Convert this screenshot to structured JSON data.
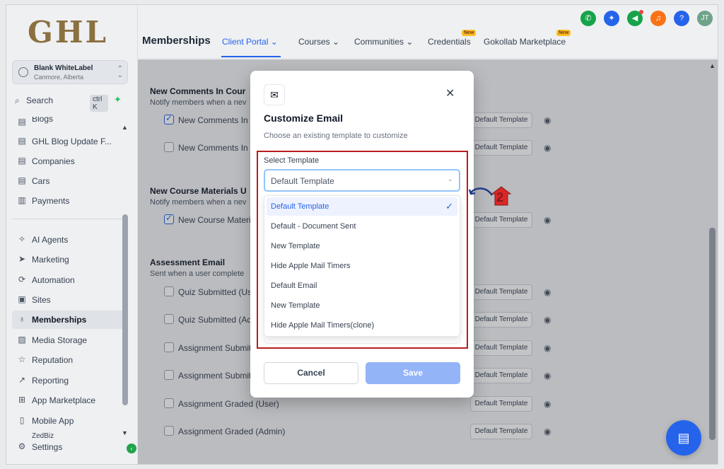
{
  "app": {
    "logo": "GHL"
  },
  "account": {
    "name": "Blank WhiteLabel",
    "location": "Canmore, Alberta"
  },
  "search": {
    "label": "Search",
    "shortcut": "ctrl K"
  },
  "sidebar": {
    "items": [
      {
        "label": "Blogs",
        "icon": "doc-icon"
      },
      {
        "label": "GHL Blog Update F...",
        "icon": "doc-icon"
      },
      {
        "label": "Companies",
        "icon": "doc-icon"
      },
      {
        "label": "Cars",
        "icon": "doc-icon"
      },
      {
        "label": "Payments",
        "icon": "receipt-icon"
      },
      {
        "label": "AI Agents",
        "icon": "sparkle-icon"
      },
      {
        "label": "Marketing",
        "icon": "send-icon"
      },
      {
        "label": "Automation",
        "icon": "automation-icon"
      },
      {
        "label": "Sites",
        "icon": "sites-icon"
      },
      {
        "label": "Memberships",
        "icon": "award-icon"
      },
      {
        "label": "Media Storage",
        "icon": "image-icon"
      },
      {
        "label": "Reputation",
        "icon": "star-icon"
      },
      {
        "label": "Reporting",
        "icon": "trend-icon"
      },
      {
        "label": "App Marketplace",
        "icon": "grid-icon"
      },
      {
        "label": "Mobile App",
        "icon": "phone-icon"
      },
      {
        "label": "ZedBiz",
        "icon": "doc-icon"
      },
      {
        "label": "Settings",
        "icon": "gear-icon"
      }
    ]
  },
  "header": {
    "title": "Memberships",
    "tabs": [
      {
        "label": "Client Portal",
        "active": true
      },
      {
        "label": "Courses"
      },
      {
        "label": "Communities"
      },
      {
        "label": "Credentials",
        "badge": "New"
      },
      {
        "label": "Gokollab Marketplace",
        "badge": "New"
      }
    ],
    "avatar_initials": "JT",
    "icon_colors": {
      "phone": "#16a34a",
      "magic": "#2563eb",
      "megaphone": "#16a34a",
      "bell": "#f97316",
      "help": "#2563eb",
      "avatar": "#6ea38a"
    }
  },
  "main": {
    "sections": [
      {
        "title": "New Comments In Cour",
        "subtitle": "Notify members when a nev",
        "rows": [
          {
            "label": "New Comments In C",
            "checked": true,
            "template": "Default Template"
          },
          {
            "label": "New Comments In C",
            "checked": false,
            "template": "Default Template"
          }
        ]
      },
      {
        "title": "New Course Materials U",
        "subtitle": "Notify members when a nev",
        "rows": [
          {
            "label": "New Course Materia",
            "checked": true,
            "template": "Default Template"
          }
        ]
      },
      {
        "title": "Assessment Email",
        "subtitle": "Sent when a user complete",
        "rows": [
          {
            "label": "Quiz Submitted (Use",
            "checked": false,
            "template": "Default Template"
          },
          {
            "label": "Quiz Submitted (Ad",
            "checked": false,
            "template": "Default Template"
          },
          {
            "label": "Assignment Submit",
            "checked": false,
            "template": "Default Template"
          },
          {
            "label": "Assignment Submit",
            "checked": false,
            "template": "Default Template"
          },
          {
            "label": "Assignment Graded (User)",
            "checked": false,
            "template": "Default Template"
          },
          {
            "label": "Assignment Graded (Admin)",
            "checked": false,
            "template": "Default Template"
          }
        ]
      }
    ]
  },
  "modal": {
    "title": "Customize Email",
    "subtitle": "Choose an existing template to customize",
    "select_label": "Select Template",
    "select_value": "Default Template",
    "options": [
      "Default Template",
      "Default - Document Sent",
      "New Template",
      "Hide Apple Mail Timers",
      "Default Email",
      "New Template",
      "Hide Apple Mail Timers(clone)"
    ],
    "selected_index": 0,
    "cancel_label": "Cancel",
    "save_label": "Save"
  },
  "annotation": {
    "step": "2",
    "color": "#b91c1c"
  },
  "colors": {
    "accent": "#2563eb",
    "save_disabled": "#93b4f7"
  }
}
